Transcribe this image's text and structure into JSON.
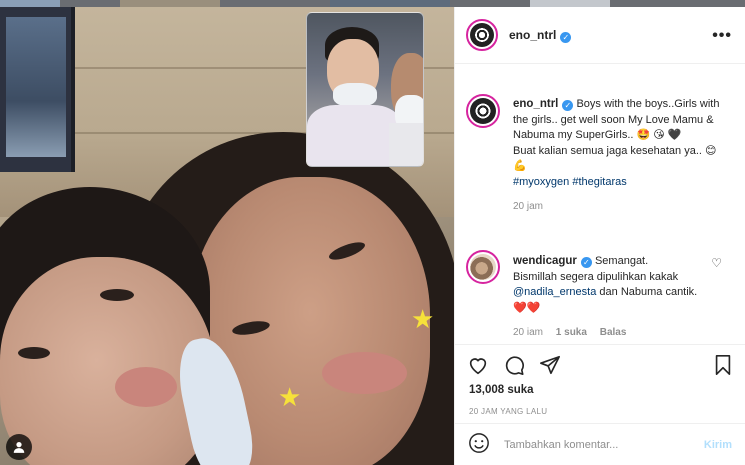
{
  "post": {
    "username": "eno_ntrl",
    "verified": true,
    "more_label": "•••"
  },
  "caption": {
    "username": "eno_ntrl",
    "line1": "Boys with the boys..Girls with the girls.. get well soon My Love Mamu & Nabuma my SuperGirls..",
    "emoji1": "🤩",
    "emoji2": "😘",
    "emoji3": "🖤",
    "line2": "Buat kalian semua jaga kesehatan ya..",
    "emoji4": "😊",
    "emoji5": "💪",
    "hashtag1": "#myoxygen",
    "hashtag2": "#thegitaras",
    "time": "20 jam"
  },
  "comment": {
    "username": "wendicagur",
    "text1": "Semangat.",
    "text2": "Bismillah segera dipulihkan kakak",
    "mention": "@nadila_ernesta",
    "text3": "dan Nabuma cantik.",
    "emoji_hearts": "❤️❤️",
    "time": "20 iam",
    "likes": "1 suka",
    "reply": "Balas"
  },
  "actions": {
    "likes": "13,008 suka",
    "timestamp": "20 JAM YANG LALU"
  },
  "composer": {
    "placeholder": "Tambahkan komentar...",
    "post_label": "Kirim"
  },
  "colors": {
    "accent_link": "#00376b",
    "verified": "#3897f0",
    "post_disabled": "#b2dffc",
    "heart": "#ed4956"
  },
  "icons": [
    "verified-icon",
    "more-icon",
    "heart-icon",
    "comment-icon",
    "share-icon",
    "bookmark-icon",
    "emoji-icon",
    "user-tag-icon"
  ]
}
